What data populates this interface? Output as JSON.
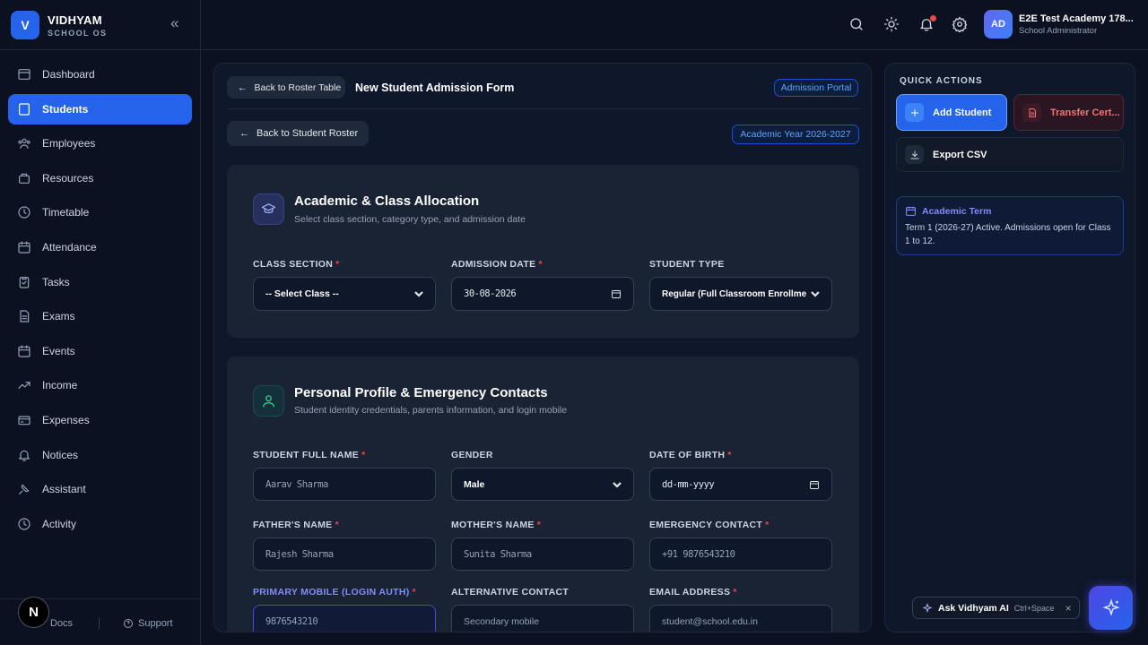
{
  "brand": {
    "name": "VIDHYAM",
    "sub": "SCHOOL OS",
    "logo_letter": "V"
  },
  "sidebar": {
    "items": [
      {
        "label": "Dashboard",
        "icon": "dashboard-icon"
      },
      {
        "label": "Students",
        "icon": "students-icon",
        "active": true
      },
      {
        "label": "Employees",
        "icon": "employees-icon"
      },
      {
        "label": "Resources",
        "icon": "resources-icon"
      },
      {
        "label": "Timetable",
        "icon": "clock-icon"
      },
      {
        "label": "Attendance",
        "icon": "calendar-icon"
      },
      {
        "label": "Tasks",
        "icon": "clipboard-icon"
      },
      {
        "label": "Exams",
        "icon": "document-icon"
      },
      {
        "label": "Events",
        "icon": "calendar-icon"
      },
      {
        "label": "Income",
        "icon": "trend-icon"
      },
      {
        "label": "Expenses",
        "icon": "wallet-icon"
      },
      {
        "label": "Notices",
        "icon": "bell-icon"
      },
      {
        "label": "Assistant",
        "icon": "assistant-icon"
      },
      {
        "label": "Activity",
        "icon": "activity-icon"
      }
    ],
    "footer": {
      "docs": "Docs",
      "support": "Support",
      "badge": "N"
    }
  },
  "topbar": {
    "user_initials": "AD",
    "user_name": "E2E Test Academy 178...",
    "user_role": "School Administrator",
    "colors": {
      "notification_dot": "#ef4444"
    }
  },
  "main": {
    "back_table": "Back to Roster Table",
    "form_title": "New Student Admission Form",
    "portal_pill": "Admission Portal",
    "back_roster": "Back to Student Roster",
    "year_pill": "Academic Year 2026-2027",
    "academic": {
      "title": "Academic & Class Allocation",
      "subtitle": "Select class section, category type, and admission date",
      "class_label": "CLASS SECTION",
      "class_value": "-- Select Class --",
      "date_label": "ADMISSION DATE",
      "date_value": "30-08-2026",
      "type_label": "STUDENT TYPE",
      "type_value": "Regular (Full Classroom Enrollme"
    },
    "personal": {
      "title": "Personal Profile & Emergency Contacts",
      "subtitle": "Student identity credentials, parents information, and login mobile",
      "name_label": "STUDENT FULL NAME",
      "name_placeholder": "Aarav Sharma",
      "gender_label": "GENDER",
      "gender_value": "Male",
      "dob_label": "DATE OF BIRTH",
      "dob_value": "dd-mm-yyyy",
      "father_label": "FATHER'S NAME",
      "father_placeholder": "Rajesh Sharma",
      "mother_label": "MOTHER'S NAME",
      "mother_placeholder": "Sunita Sharma",
      "emergency_label": "EMERGENCY CONTACT",
      "emergency_placeholder": "+91 9876543210",
      "mobile_label": "PRIMARY MOBILE (LOGIN AUTH)",
      "mobile_placeholder": "9876543210",
      "alt_label": "ALTERNATIVE CONTACT",
      "alt_placeholder": "Secondary mobile",
      "email_label": "EMAIL ADDRESS",
      "email_placeholder": "student@school.edu.in"
    }
  },
  "quick_actions": {
    "title": "QUICK ACTIONS",
    "add_student": "Add Student",
    "transfer": "Transfer Cert...",
    "export": "Export CSV",
    "term_title": "Academic Term",
    "term_text": "Term 1 (2026-27) Active. Admissions open for Class 1 to 12."
  },
  "assistant": {
    "label": "Ask Vidhyam AI",
    "shortcut": "Ctrl+Space"
  }
}
